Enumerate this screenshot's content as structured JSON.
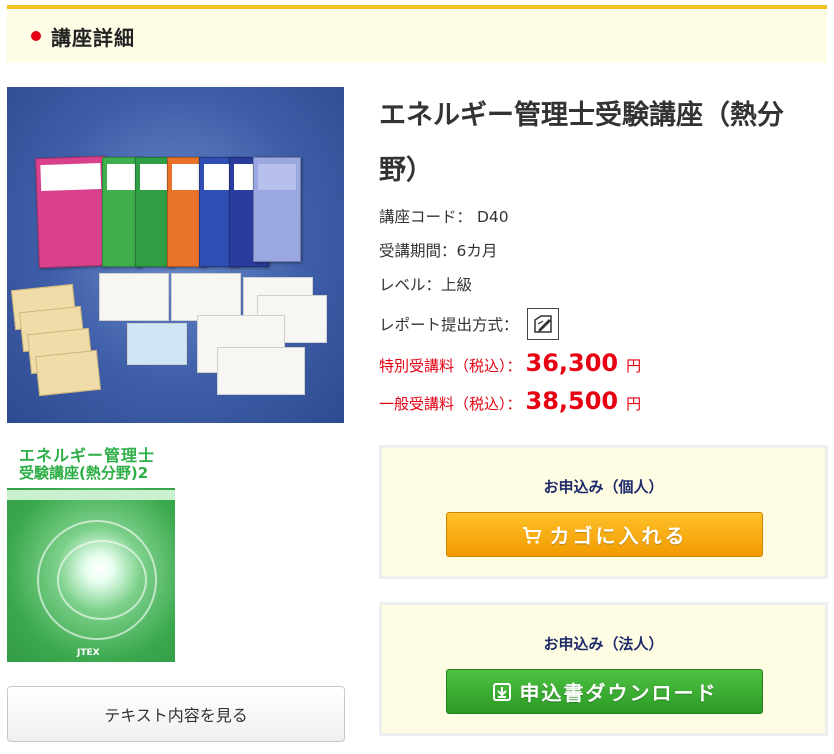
{
  "header": {
    "title": "講座詳細"
  },
  "course": {
    "title": "エネルギー管理士受験講座（熱分野）",
    "code_label": "講座コード：",
    "code_value": "D40",
    "period_label": "受講期間：",
    "period_value": "6カ月",
    "level_label": "レベル：",
    "level_value": "上級",
    "report_label": "レポート提出方式：",
    "report_icon": "pen-paper-icon"
  },
  "prices": {
    "special_label": "特別受講料（税込）：",
    "special_value": "36,300",
    "general_label": "一般受講料（税込）：",
    "general_value": "38,500",
    "yen": "円"
  },
  "order": {
    "individual_label": "お申込み（個人）",
    "cart_button": "カゴに入れる",
    "corporate_label": "お申込み（法人）",
    "download_button": "申込書ダウンロード"
  },
  "images": {
    "sub_cover_line1": "エネルギー管理士",
    "sub_cover_line2": "受験講座(熱分野)2",
    "sub_logo": "JTEX"
  },
  "text_button": "テキスト内容を見る",
  "colors": {
    "accent_red": "#e60012",
    "header_bar": "#f3c11d",
    "cart_orange": "#f19a00",
    "download_green": "#2b9a25",
    "order_label_navy": "#1f2a6b"
  }
}
